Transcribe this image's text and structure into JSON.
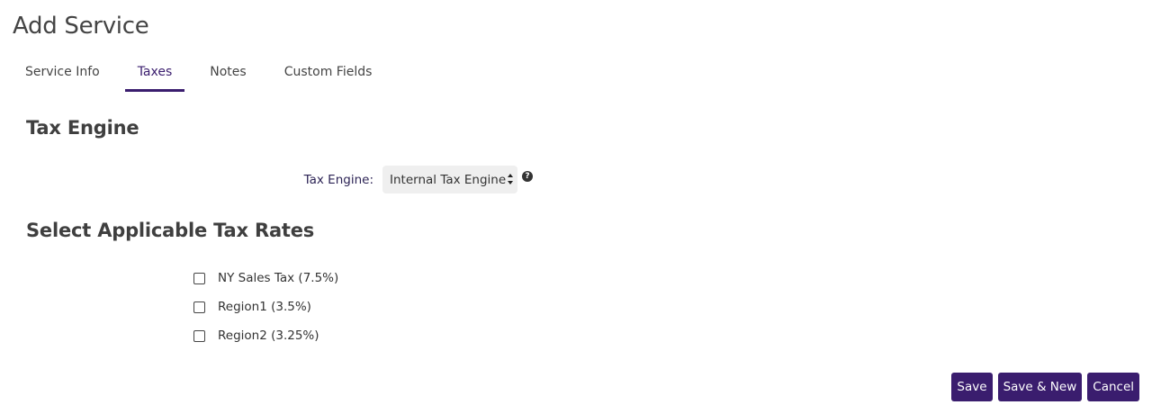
{
  "page_title": "Add Service",
  "tabs": [
    {
      "label": "Service Info",
      "active": false
    },
    {
      "label": "Taxes",
      "active": true
    },
    {
      "label": "Notes",
      "active": false
    },
    {
      "label": "Custom Fields",
      "active": false
    }
  ],
  "tax_engine_section": {
    "heading": "Tax Engine",
    "field_label": "Tax Engine:",
    "selected_value": "Internal Tax Engine",
    "help_icon": "question-circle-icon"
  },
  "tax_rates_section": {
    "heading": "Select Applicable Tax Rates",
    "rates": [
      {
        "label": "NY Sales Tax (7.5%)",
        "checked": false
      },
      {
        "label": "Region1 (3.5%)",
        "checked": false
      },
      {
        "label": "Region2 (3.25%)",
        "checked": false
      }
    ]
  },
  "actions": {
    "save_label": "Save",
    "save_new_label": "Save & New",
    "cancel_label": "Cancel"
  },
  "colors": {
    "accent": "#3a1d6e",
    "select_background": "#efefef"
  }
}
